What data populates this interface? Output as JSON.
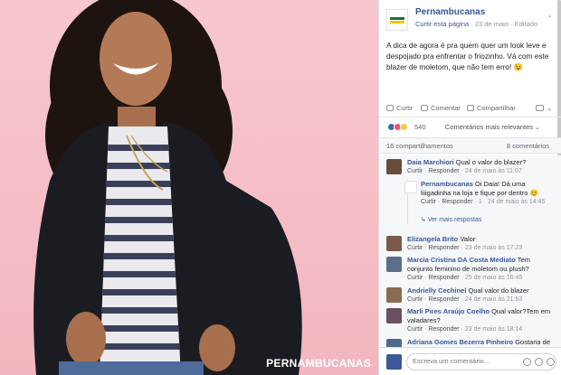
{
  "photo": {
    "watermark": "PERNAMBUCANAS"
  },
  "post": {
    "page_name": "Pernambucanas",
    "follow": "Curtir esta página",
    "date": "23 de maio",
    "edited": "Editado",
    "caption": "A dica de agora é pra quem quer um look leve e despojado pra enfrentar o friozinho. Vá com este blazer de moletom, que não tem erro! 😉"
  },
  "actions": {
    "like": "Curtir",
    "comment": "Comentar",
    "share": "Compartilhar"
  },
  "reactions": {
    "count": "540",
    "sort": "Comentários mais relevantes"
  },
  "stats": {
    "shares": "16 compartilhamentos",
    "comments": "8 comentários"
  },
  "comments": [
    {
      "name": "Daia Marchiori",
      "text": "Qual o valor do blazer?",
      "like": "Curtir",
      "reply": "Responder",
      "time": "24 de maio às 11:07",
      "avatar_color": "#6b4b3a"
    },
    {
      "name": "Pernambucanas",
      "text": "Oi Daia! Dá uma liiigadinha na loja e fique por dentro 😊",
      "like": "Curtir",
      "reply": "Responder",
      "likes": "1",
      "time": "24 de maio às 14:45",
      "more": "Ver mais respostas"
    },
    {
      "name": "Elizangela Brito",
      "text": "Valor",
      "like": "Curtir",
      "reply": "Responder",
      "time": "23 de maio às 17:23",
      "avatar_color": "#7a5a4a"
    },
    {
      "name": "Marcia Cristina DA Costa Mediato",
      "text": "Tem conjunto feminino de moletom ou plush?",
      "like": "Curtir",
      "reply": "Responder",
      "time": "25 de maio às 16:45",
      "avatar_color": "#5b6f8a"
    },
    {
      "name": "Andrielly Cechinel",
      "text": "Qual valor do blazer",
      "like": "Curtir",
      "reply": "Responder",
      "time": "24 de maio às 21:53",
      "avatar_color": "#8a6a52"
    },
    {
      "name": "Marli Pires Araújo Coelho",
      "text": "Qual valor?Tem em valadares?",
      "like": "Curtir",
      "reply": "Responder",
      "time": "23 de maio às 18:14",
      "avatar_color": "#6a5060"
    },
    {
      "name": "Adriana Gomes Bezerra Pinheiro",
      "text": "Gostaria de saber se tem o blazer",
      "avatar_color": "#4d6a8f"
    }
  ],
  "compose": {
    "placeholder": "Escreva um comentário..."
  }
}
